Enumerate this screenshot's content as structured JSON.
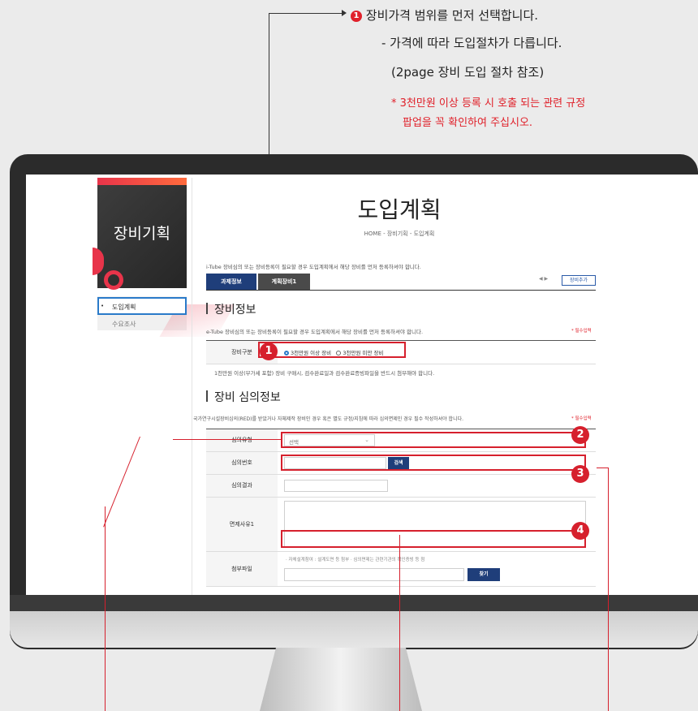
{
  "annotation": {
    "badge": "1",
    "line1": "장비가격 범위를 먼저 선택합니다.",
    "line2": "- 가격에 따라 도입절차가 다릅니다.",
    "line3": "(2page 장비 도입 절차 참조)",
    "note1": "* 3천만원 이상 등록 시 호출 되는 관련 규정",
    "note2": "팝업을 꼭 확인하여 주십시오."
  },
  "sidebar": {
    "title": "장비기획",
    "items": [
      {
        "label": "도입계획"
      },
      {
        "label": "수요조사"
      }
    ]
  },
  "header": {
    "title": "도입계획",
    "breadcrumb": "HOME  -  장비기획  -  도입계획"
  },
  "intro_text": "i-Tube 장비심의 또는 장비등록이 필요할 경우 도입계획에서 해당 장비를 먼저 등록하셔야 합니다.",
  "tabs": [
    {
      "label": "과제정보"
    },
    {
      "label": "계획장비1"
    }
  ],
  "tab_controls": {
    "arrows": "◀  ▶",
    "add_button": "장비추가"
  },
  "equipment_info": {
    "section_title": "장비정보",
    "desc": "e-Tube 장비심의 또는 장비등록이 필요할 경우 도입계획에서 해당 장비를 먼저 등록하셔야 합니다.",
    "required_note": "* 필수입력",
    "type_label": "장비구분",
    "options": [
      {
        "label": "3천만원 이상 장비",
        "selected": true
      },
      {
        "label": "3천만원 미만 장비",
        "selected": false
      }
    ],
    "notice": "1천만원 이상(부가세 포함) 장비 구매시, 검수완료일과 검수완료증빙파일을 반드시 첨부해야 합니다."
  },
  "review_info": {
    "section_title": "장비 심의정보",
    "desc": "국가연구시설장비심의(RED)를 받았거나 자체제작 장비인 경우 혹은 별도 규정/지침에 따라 심의면제인 경우 필수 작성하셔야 합니다.",
    "required_note": "* 필수입력",
    "rows": {
      "type_label": "심의유형",
      "type_value": "선택",
      "number_label": "심의번호",
      "search_button": "검색",
      "result_label": "심의결과",
      "exempt_label": "면제사유1",
      "attach_label": "첨부파일",
      "attach_hint": "· 자체설계참여 : 설계도면 등 첨부  · 심의면제는 관련기관의 확인증빙 등 첨",
      "find_button": "찾기"
    }
  },
  "markers": [
    "1",
    "2",
    "3",
    "4"
  ],
  "colors": {
    "accent_red": "#d6202d",
    "brand_navy": "#1f3e7a",
    "highlight_blue": "#2a7ac9"
  }
}
